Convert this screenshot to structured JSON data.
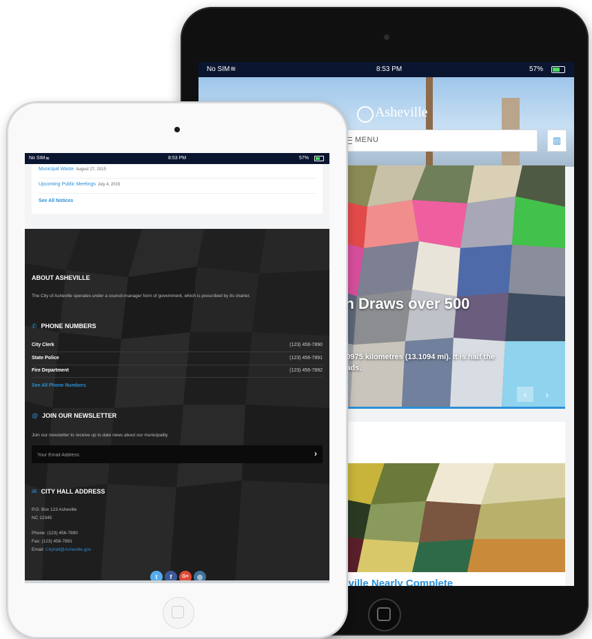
{
  "back_ipad": {
    "status_bar": {
      "carrier": "No SIM",
      "time": "8:53 PM",
      "battery": "57%"
    },
    "logo_text": "Asheville",
    "menu_label": "MENU",
    "map_icon": "map-icon",
    "slider": {
      "title": "athon Draws over 500",
      "subtitle_line1": "ent of 21.0975 kilometres (13.1094 mi). It is half the",
      "subtitle_line2": "run on roads.",
      "prev_label": "‹",
      "next_label": "›"
    },
    "card_title": "heville Nearly Complete"
  },
  "front_ipad": {
    "status_bar": {
      "carrier": "No SIM",
      "time": "8:53 PM",
      "battery": "57%"
    },
    "notices": [
      {
        "title": "Municipal Waste",
        "date": "August 27, 2015"
      },
      {
        "title": "Upcoming Public Meetings",
        "date": "July 4, 2015"
      }
    ],
    "see_all_notices": "See All Notices",
    "about": {
      "heading": "ABOUT ASHEVILLE",
      "text": "The City of Asheville operates under a council-manager form of government, which is prescribed by its charter."
    },
    "phone": {
      "heading": "PHONE NUMBERS",
      "rows": [
        {
          "name": "City Clerk",
          "number": "(123) 456-7890"
        },
        {
          "name": "State Police",
          "number": "(123) 456-7891"
        },
        {
          "name": "Fire Department",
          "number": "(123) 456-7892"
        }
      ],
      "see_all": "See All Phone Numbers"
    },
    "newsletter": {
      "heading": "JOIN OUR NEWSLETTER",
      "text": "Join our newsletter to receive up to date news about our municipality.",
      "placeholder": "Your Email Address",
      "submit": "›"
    },
    "address": {
      "heading": "CITY HALL ADDRESS",
      "line1": "P.O. Box 123 Asheville",
      "line2": "NC 12345",
      "phone": "Phone: (123) 456-7890",
      "fax": "Fax: (123) 456-7891",
      "email_label": "Email:",
      "email": "Cityhall@Asheville.gov"
    },
    "social": [
      {
        "name": "twitter-icon",
        "glyph": "t",
        "color": "#55acee"
      },
      {
        "name": "facebook-icon",
        "glyph": "f",
        "color": "#3b5998"
      },
      {
        "name": "google-plus-icon",
        "glyph": "G+",
        "color": "#dd4b39"
      },
      {
        "name": "instagram-icon",
        "glyph": "◎",
        "color": "#3f729b"
      }
    ]
  },
  "colors": {
    "accent": "#2c8fd7",
    "footer_bg": "#1d1d1d",
    "status_bg": "#0a1530"
  }
}
